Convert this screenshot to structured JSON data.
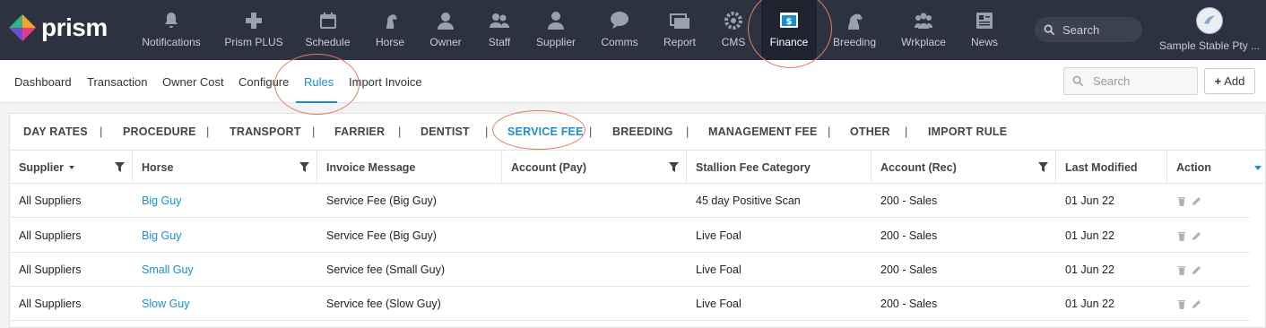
{
  "brand": {
    "name": "prism"
  },
  "topnav": [
    {
      "label": "Notifications",
      "icon": "bell-icon"
    },
    {
      "label": "Prism PLUS",
      "icon": "plus-cross-icon"
    },
    {
      "label": "Schedule",
      "icon": "calendar-icon"
    },
    {
      "label": "Horse",
      "icon": "horse-head-icon"
    },
    {
      "label": "Owner",
      "icon": "person-icon"
    },
    {
      "label": "Staff",
      "icon": "people-icon"
    },
    {
      "label": "Supplier",
      "icon": "supplier-person-icon"
    },
    {
      "label": "Comms",
      "icon": "chat-bubble-icon"
    },
    {
      "label": "Report",
      "icon": "report-stack-icon"
    },
    {
      "label": "CMS",
      "icon": "gear-icon"
    },
    {
      "label": "Finance",
      "icon": "dollar-screen-icon"
    },
    {
      "label": "Breeding",
      "icon": "horse-breeding-icon"
    },
    {
      "label": "Wrkplace",
      "icon": "group-icon"
    },
    {
      "label": "News",
      "icon": "newspaper-icon"
    }
  ],
  "top_search": {
    "placeholder": "Search"
  },
  "account": {
    "name": "Sample Stable Pty ..."
  },
  "subnav": {
    "tabs": [
      "Dashboard",
      "Transaction",
      "Owner Cost",
      "Configure",
      "Rules",
      "Import Invoice"
    ],
    "search_placeholder": "Search",
    "add_label": "Add"
  },
  "rule_tabs": [
    "DAY RATES",
    "PROCEDURE",
    "TRANSPORT",
    "FARRIER",
    "DENTIST",
    "SERVICE FEE",
    "BREEDING",
    "MANAGEMENT FEE",
    "OTHER",
    "IMPORT RULE"
  ],
  "separator": "|",
  "table": {
    "headers": [
      "Supplier",
      "Horse",
      "Invoice Message",
      "Account (Pay)",
      "Stallion Fee Category",
      "Account (Rec)",
      "Last Modified",
      "Action"
    ],
    "rows": [
      {
        "supplier": "All Suppliers",
        "horse": "Big Guy",
        "message": "Service Fee (Big Guy)",
        "account_pay": "",
        "category": "45 day Positive Scan",
        "account_rec": "200 - Sales",
        "modified": "01 Jun 22"
      },
      {
        "supplier": "All Suppliers",
        "horse": "Big Guy",
        "message": "Service Fee (Big Guy)",
        "account_pay": "",
        "category": "Live Foal",
        "account_rec": "200 - Sales",
        "modified": "01 Jun 22"
      },
      {
        "supplier": "All Suppliers",
        "horse": "Small Guy",
        "message": "Service fee (Small Guy)",
        "account_pay": "",
        "category": "Live Foal",
        "account_rec": "200 - Sales",
        "modified": "01 Jun 22"
      },
      {
        "supplier": "All Suppliers",
        "horse": "Slow Guy",
        "message": "Service fee (Slow Guy)",
        "account_pay": "",
        "category": "Live Foal",
        "account_rec": "200 - Sales",
        "modified": "01 Jun 22"
      }
    ]
  },
  "colors": {
    "topbar": "#2d3241",
    "accent": "#1a8fd0",
    "annotation": "#e07a63"
  }
}
